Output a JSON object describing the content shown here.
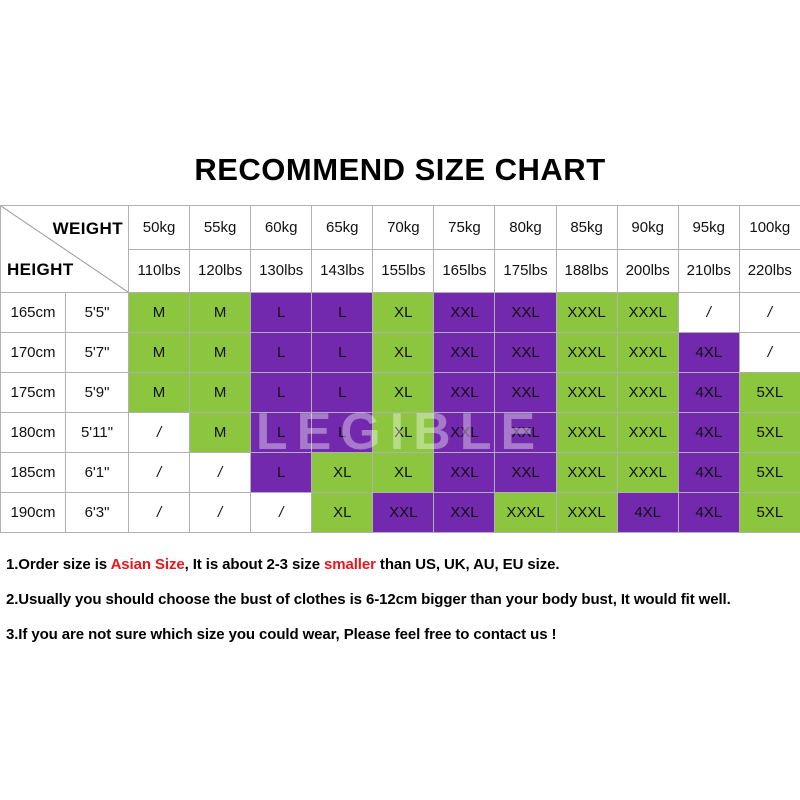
{
  "title": "RECOMMEND SIZE CHART",
  "watermark": "LEGIBLE",
  "colors": {
    "green": "#8CC63E",
    "purple": "#7229AD",
    "white": "#FFFFFF",
    "grid": "#B0B0B0",
    "highlight_red": "#E8161D"
  },
  "table": {
    "corner": {
      "weight_label": "WEIGHT",
      "height_label": "HEIGHT"
    },
    "weight_kg": [
      "50kg",
      "55kg",
      "60kg",
      "65kg",
      "70kg",
      "75kg",
      "80kg",
      "85kg",
      "90kg",
      "95kg",
      "100kg"
    ],
    "weight_lbs": [
      "110lbs",
      "120lbs",
      "130lbs",
      "143lbs",
      "155lbs",
      "165lbs",
      "175lbs",
      "188lbs",
      "200lbs",
      "210lbs",
      "220lbs"
    ],
    "rows": [
      {
        "height_cm": "165cm",
        "height_ft": "5'5\"",
        "sizes": [
          "M",
          "M",
          "L",
          "L",
          "XL",
          "XXL",
          "XXL",
          "XXXL",
          "XXXL",
          "/",
          "/"
        ],
        "fills": [
          "g",
          "g",
          "p",
          "p",
          "g",
          "p",
          "p",
          "g",
          "g",
          "w",
          "w"
        ]
      },
      {
        "height_cm": "170cm",
        "height_ft": "5'7\"",
        "sizes": [
          "M",
          "M",
          "L",
          "L",
          "XL",
          "XXL",
          "XXL",
          "XXXL",
          "XXXL",
          "4XL",
          "/"
        ],
        "fills": [
          "g",
          "g",
          "p",
          "p",
          "g",
          "p",
          "p",
          "g",
          "g",
          "p",
          "w"
        ]
      },
      {
        "height_cm": "175cm",
        "height_ft": "5'9\"",
        "sizes": [
          "M",
          "M",
          "L",
          "L",
          "XL",
          "XXL",
          "XXL",
          "XXXL",
          "XXXL",
          "4XL",
          "5XL"
        ],
        "fills": [
          "g",
          "g",
          "p",
          "p",
          "g",
          "p",
          "p",
          "g",
          "g",
          "p",
          "g"
        ]
      },
      {
        "height_cm": "180cm",
        "height_ft": "5'11\"",
        "sizes": [
          "/",
          "M",
          "L",
          "L",
          "XL",
          "XXL",
          "XXL",
          "XXXL",
          "XXXL",
          "4XL",
          "5XL"
        ],
        "fills": [
          "w",
          "g",
          "p",
          "p",
          "g",
          "p",
          "p",
          "g",
          "g",
          "p",
          "g"
        ]
      },
      {
        "height_cm": "185cm",
        "height_ft": "6'1\"",
        "sizes": [
          "/",
          "/",
          "L",
          "XL",
          "XL",
          "XXL",
          "XXL",
          "XXXL",
          "XXXL",
          "4XL",
          "5XL"
        ],
        "fills": [
          "w",
          "w",
          "p",
          "g",
          "g",
          "p",
          "p",
          "g",
          "g",
          "p",
          "g"
        ]
      },
      {
        "height_cm": "190cm",
        "height_ft": "6'3\"",
        "sizes": [
          "/",
          "/",
          "/",
          "XL",
          "XXL",
          "XXL",
          "XXXL",
          "XXXL",
          "4XL",
          "4XL",
          "5XL"
        ],
        "fills": [
          "w",
          "w",
          "w",
          "g",
          "p",
          "p",
          "g",
          "g",
          "p",
          "p",
          "g"
        ]
      }
    ]
  },
  "notes": [
    {
      "parts": [
        {
          "text": "1.Order size is ",
          "highlight": false
        },
        {
          "text": "Asian Size",
          "highlight": true
        },
        {
          "text": ", It is about 2-3 size ",
          "highlight": false
        },
        {
          "text": "smaller",
          "highlight": true
        },
        {
          "text": " than US, UK, AU, EU size.",
          "highlight": false
        }
      ]
    },
    {
      "parts": [
        {
          "text": "2.Usually you should choose the bust of clothes is 6-12cm bigger than your body bust, It would fit well.",
          "highlight": false
        }
      ]
    },
    {
      "parts": [
        {
          "text": "3.If you are not sure which size you could wear, Please feel free to contact us !",
          "highlight": false
        }
      ]
    }
  ]
}
